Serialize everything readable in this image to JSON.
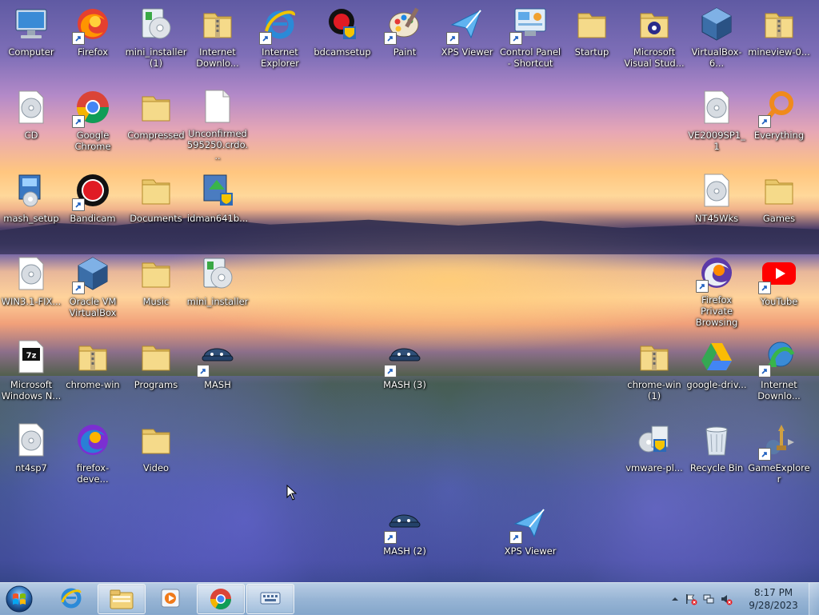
{
  "desktop": {
    "icons": [
      {
        "label": "Computer",
        "icon": "computer-icon",
        "shortcut": false
      },
      {
        "label": "Firefox",
        "icon": "firefox-icon",
        "shortcut": true
      },
      {
        "label": "mini_installer (1)",
        "icon": "installer-icon",
        "shortcut": false
      },
      {
        "label": "Internet Downlo...",
        "icon": "folder-zip-icon",
        "shortcut": false
      },
      {
        "label": "Internet Explorer",
        "icon": "ie-icon",
        "shortcut": true
      },
      {
        "label": "bdcamsetup",
        "icon": "bandicam-setup-icon",
        "shortcut": false
      },
      {
        "label": "Paint",
        "icon": "paint-icon",
        "shortcut": true
      },
      {
        "label": "XPS Viewer",
        "icon": "xps-viewer-icon",
        "shortcut": true
      },
      {
        "label": "Control Panel - Shortcut",
        "icon": "control-panel-icon",
        "shortcut": true
      },
      {
        "label": "Startup",
        "icon": "folder-icon",
        "shortcut": false
      },
      {
        "label": "Microsoft Visual Stud...",
        "icon": "visual-studio-folder-icon",
        "shortcut": false
      },
      {
        "label": "VirtualBox-6...",
        "icon": "virtualbox-icon",
        "shortcut": false
      },
      {
        "label": "mineview-0...",
        "icon": "folder-zip-icon",
        "shortcut": false
      },
      {
        "label": "CD",
        "icon": "disc-icon",
        "shortcut": false
      },
      {
        "label": "Google Chrome",
        "icon": "chrome-icon",
        "shortcut": true
      },
      {
        "label": "Compressed",
        "icon": "folder-icon",
        "shortcut": false
      },
      {
        "label": "Unconfirmed 595250.crdo...",
        "icon": "blank-file-icon",
        "shortcut": false
      },
      {
        "label": "VE2009SP1_1",
        "icon": "disc-icon",
        "shortcut": false
      },
      {
        "label": "Everything",
        "icon": "everything-icon",
        "shortcut": true
      },
      {
        "label": "mash_setup",
        "icon": "setup-icon",
        "shortcut": false
      },
      {
        "label": "Bandicam",
        "icon": "bandicam-icon",
        "shortcut": true
      },
      {
        "label": "Documents",
        "icon": "folder-icon",
        "shortcut": false
      },
      {
        "label": "idman641b...",
        "icon": "idm-setup-icon",
        "shortcut": false
      },
      {
        "label": "NT45Wks",
        "icon": "disc-icon",
        "shortcut": false
      },
      {
        "label": "Games",
        "icon": "folder-icon",
        "shortcut": false
      },
      {
        "label": "WIN3.1-FIX...",
        "icon": "disc-icon",
        "shortcut": false
      },
      {
        "label": "Oracle VM VirtualBox",
        "icon": "virtualbox-icon",
        "shortcut": true
      },
      {
        "label": "Music",
        "icon": "folder-icon",
        "shortcut": false
      },
      {
        "label": "mini_installer",
        "icon": "installer-icon",
        "shortcut": false
      },
      {
        "label": "Firefox Private Browsing",
        "icon": "firefox-private-icon",
        "shortcut": true
      },
      {
        "label": "YouTube",
        "icon": "youtube-icon",
        "shortcut": true
      },
      {
        "label": "Microsoft Windows N...",
        "icon": "7zip-icon",
        "shortcut": false
      },
      {
        "label": "chrome-win",
        "icon": "folder-zip-icon",
        "shortcut": false
      },
      {
        "label": "Programs",
        "icon": "folder-icon",
        "shortcut": false
      },
      {
        "label": "MASH",
        "icon": "mash-icon",
        "shortcut": true
      },
      {
        "label": "MASH (3)",
        "icon": "mash-icon",
        "shortcut": true
      },
      {
        "label": "chrome-win (1)",
        "icon": "folder-zip-icon",
        "shortcut": false
      },
      {
        "label": "google-driv...",
        "icon": "google-drive-icon",
        "shortcut": false
      },
      {
        "label": "Internet Downlo...",
        "icon": "idm-icon",
        "shortcut": true
      },
      {
        "label": "nt4sp7",
        "icon": "disc-icon",
        "shortcut": false
      },
      {
        "label": "firefox-deve...",
        "icon": "firefox-dev-icon",
        "shortcut": false
      },
      {
        "label": "Video",
        "icon": "folder-icon",
        "shortcut": false
      },
      {
        "label": "vmware-pl...",
        "icon": "vmware-icon",
        "shortcut": false
      },
      {
        "label": "Recycle Bin",
        "icon": "recycle-bin-icon",
        "shortcut": false
      },
      {
        "label": "GameExplorer",
        "icon": "game-explorer-icon",
        "shortcut": true
      },
      {
        "label": "MASH (2)",
        "icon": "mash-icon",
        "shortcut": true
      },
      {
        "label": "XPS Viewer",
        "icon": "xps-viewer-icon",
        "shortcut": true
      }
    ]
  },
  "taskbar": {
    "start": {
      "icon": "windows-start-icon"
    },
    "items": [
      {
        "icon": "ie-icon"
      },
      {
        "icon": "explorer-folder-icon"
      },
      {
        "icon": "media-player-icon"
      },
      {
        "icon": "chrome-icon"
      },
      {
        "icon": "keyboard-icon"
      }
    ],
    "tray": {
      "time": "8:17 PM",
      "date": "9/28/2023"
    }
  }
}
